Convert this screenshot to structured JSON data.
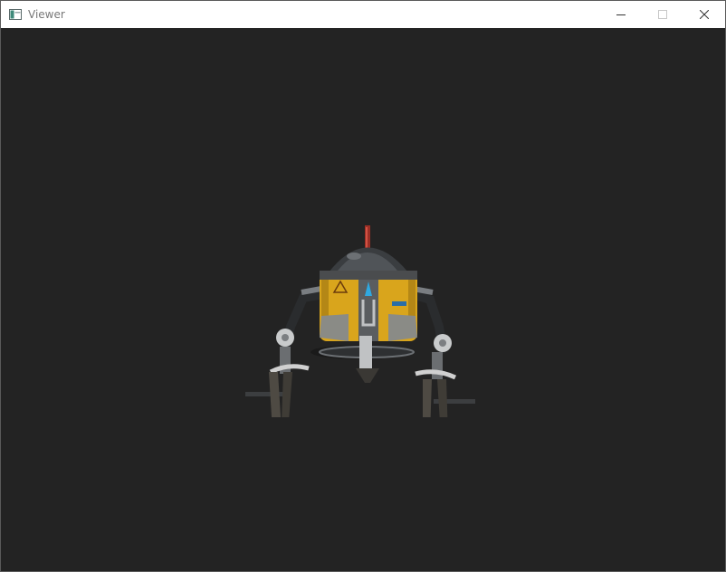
{
  "window": {
    "title": "Viewer",
    "app_icon": "window-app-icon",
    "controls": {
      "minimize": "minimize-icon",
      "maximize": "maximize-icon",
      "close": "close-icon"
    }
  },
  "viewport": {
    "background_color": "#232323",
    "model": "robot-model"
  },
  "colors": {
    "robot_body": "#d9a51c",
    "robot_metal": "#8c8f92",
    "robot_accent_blue": "#2fa8e0",
    "robot_accent_red": "#b8322a"
  }
}
